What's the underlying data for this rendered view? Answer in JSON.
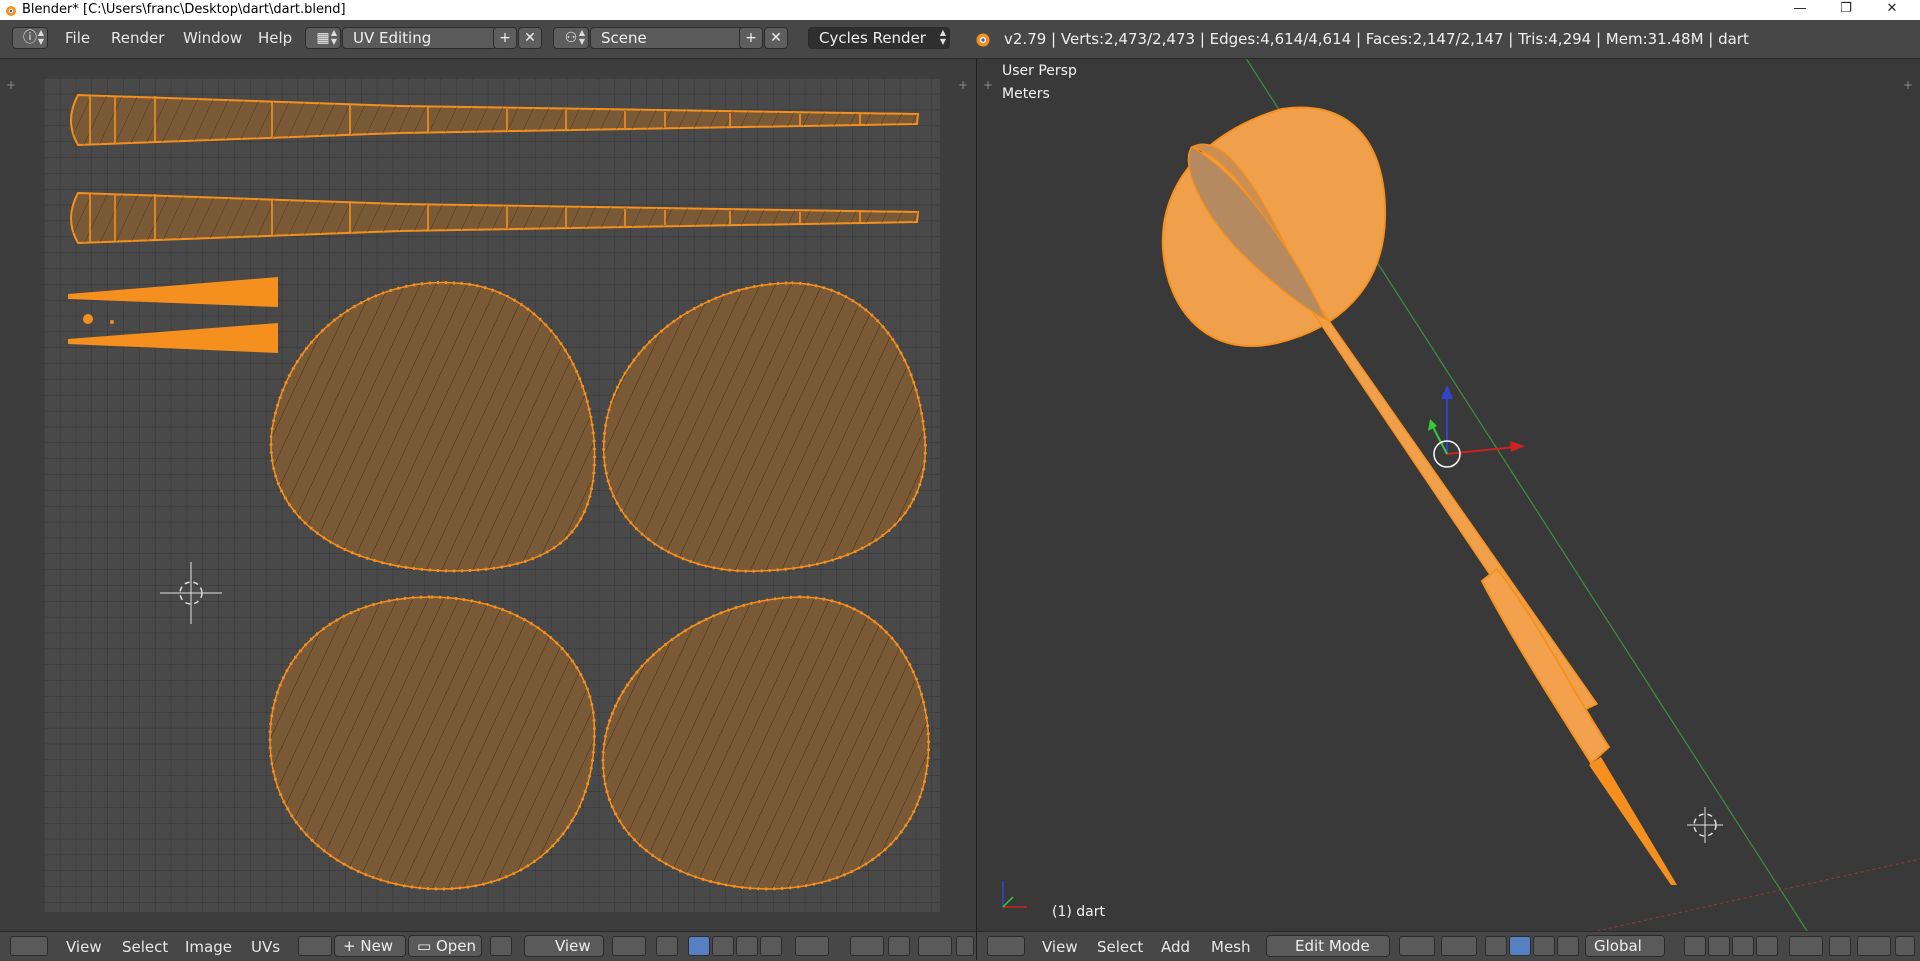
{
  "window": {
    "title": "Blender* [C:\\Users\\franc\\Desktop\\dart\\dart.blend]",
    "controls": [
      "—",
      "❐",
      "✕"
    ]
  },
  "info_header": {
    "menus": [
      "File",
      "Render",
      "Window",
      "Help"
    ],
    "screen_layout": "UV Editing",
    "scene": "Scene",
    "render_engine": "Cycles Render",
    "stats": "v2.79 | Verts:2,473/2,473 | Edges:4,614/4,614 | Faces:2,147/2,147 | Tris:4,294 | Mem:31.48M | dart"
  },
  "uv_editor": {
    "footer": {
      "menus": [
        "View",
        "Select",
        "Image",
        "UVs"
      ],
      "new_label": "New",
      "open_label": "Open",
      "view_label": "View"
    }
  },
  "viewport": {
    "overlay_view": "User Persp",
    "overlay_units": "Meters",
    "object_label": "(1) dart",
    "footer": {
      "menus": [
        "View",
        "Select",
        "Add",
        "Mesh"
      ],
      "mode": "Edit Mode",
      "orientation": "Global"
    }
  },
  "colors": {
    "accent": "#f5901e",
    "uv_fill": "#7a5a36",
    "selected_button": "#5680c2"
  },
  "icons": [
    "blender-logo-icon",
    "info-editor-icon",
    "screen-layout-icon",
    "scene-icon",
    "add-icon",
    "close-icon",
    "uv-editor-icon",
    "image-icon",
    "pin-icon",
    "pivot-icon",
    "sync-icon",
    "select-mode-icons",
    "proportional-icon",
    "snap-icon",
    "view3d-editor-icon",
    "mode-icon",
    "shading-icon",
    "pivot-point-icon",
    "manipulator-icon",
    "layers-icon"
  ]
}
